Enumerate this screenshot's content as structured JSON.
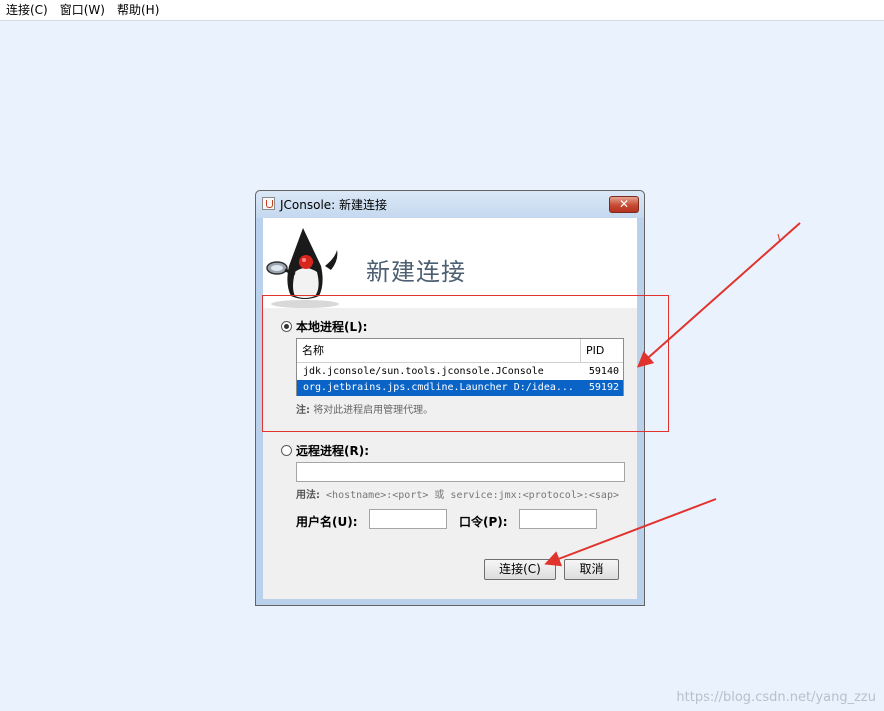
{
  "menubar": {
    "items": [
      "连接(C)",
      "窗口(W)",
      "帮助(H)"
    ]
  },
  "dialog": {
    "title": "JConsole: 新建连接",
    "close_label": "✕",
    "banner_title": "新建连接",
    "local": {
      "label": "本地进程(L):",
      "columns": {
        "name": "名称",
        "pid": "PID"
      },
      "rows": [
        {
          "name": "jdk.jconsole/sun.tools.jconsole.JConsole",
          "pid": "59140",
          "selected": false
        },
        {
          "name": "org.jetbrains.jps.cmdline.Launcher D:/idea...",
          "pid": "59192",
          "selected": true
        }
      ],
      "note_label": "注:",
      "note_text": "将对此进程启用管理代理。"
    },
    "remote": {
      "label": "远程进程(R):",
      "input_value": "",
      "usage_label": "用法:",
      "usage_text": "<hostname>:<port> 或 service:jmx:<protocol>:<sap>",
      "username_label": "用户名(U):",
      "username_value": "",
      "password_label": "口令(P):",
      "password_value": ""
    },
    "buttons": {
      "connect": "连接(C)",
      "cancel": "取消"
    }
  },
  "watermark": "https://blog.csdn.net/yang_zzu",
  "colors": {
    "annotation": "#e1332e",
    "selection": "#0a64c8"
  }
}
